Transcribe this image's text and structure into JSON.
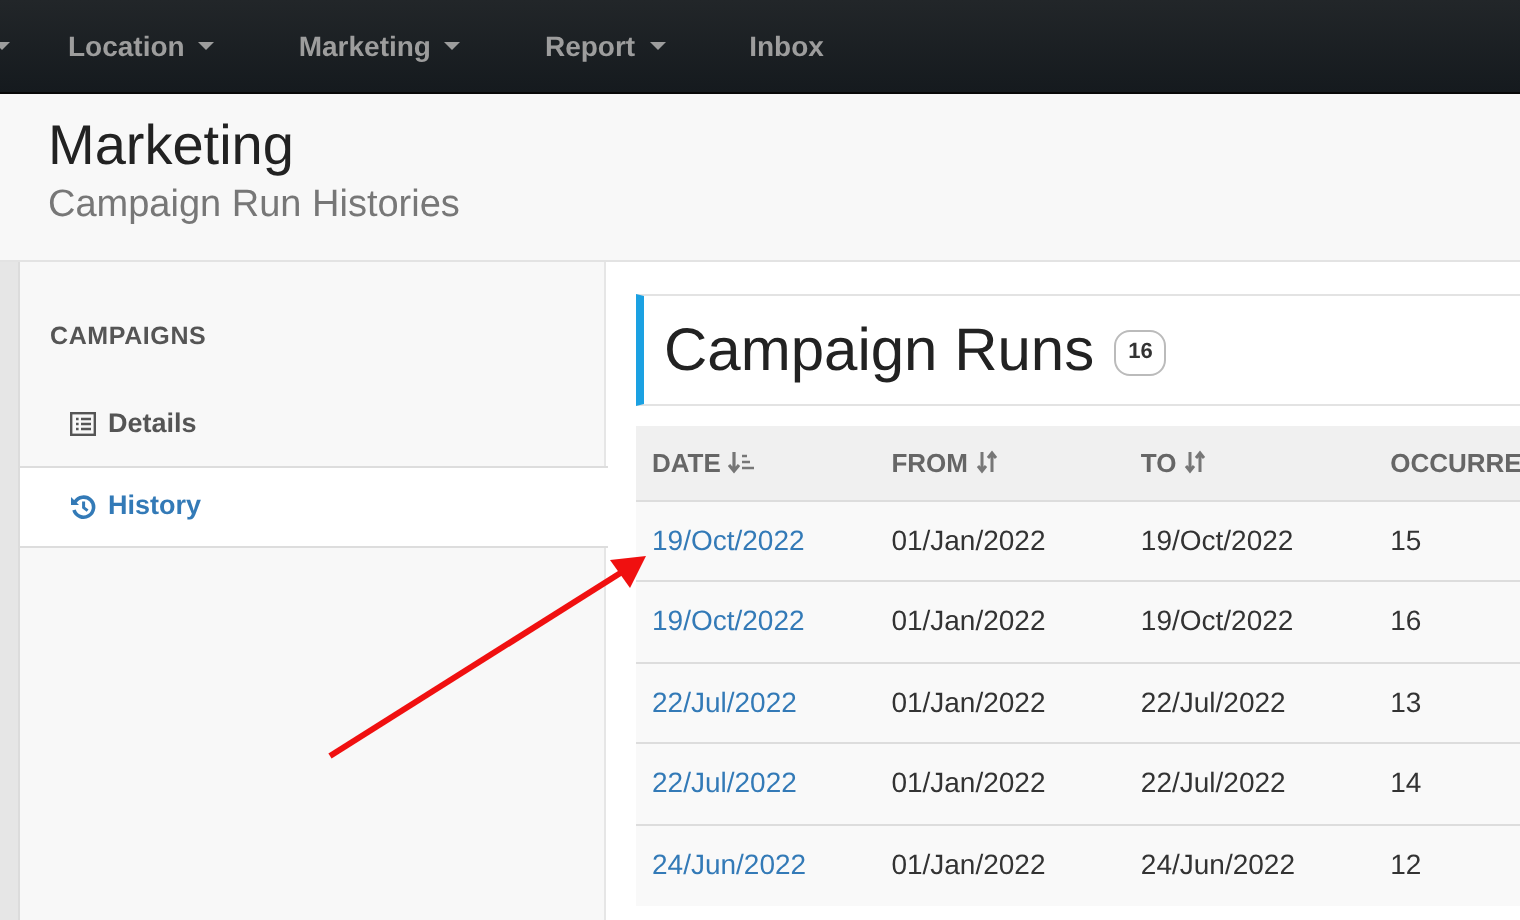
{
  "navbar": {
    "items": [
      {
        "label": "Location",
        "dropdown": true
      },
      {
        "label": "Marketing",
        "dropdown": true
      },
      {
        "label": "Report",
        "dropdown": true
      },
      {
        "label": "Inbox",
        "dropdown": false
      }
    ]
  },
  "page_header": {
    "title": "Marketing",
    "subtitle": "Campaign Run Histories"
  },
  "sidebar": {
    "heading": "CAMPAIGNS",
    "items": [
      {
        "label": "Details",
        "kind": "list",
        "selected": false
      },
      {
        "label": "History",
        "kind": "history",
        "selected": true
      }
    ]
  },
  "panel": {
    "title": "Campaign Runs",
    "count": "16"
  },
  "table": {
    "columns": [
      {
        "label": "DATE",
        "kind": "sorted"
      },
      {
        "label": "FROM",
        "kind": "sortable"
      },
      {
        "label": "TO",
        "kind": "sortable"
      },
      {
        "label": "OCCURRE",
        "kind": "plain"
      }
    ],
    "rows": [
      [
        "19/Oct/2022",
        "01/Jan/2022",
        "19/Oct/2022",
        "15"
      ],
      [
        "19/Oct/2022",
        "01/Jan/2022",
        "19/Oct/2022",
        "16"
      ],
      [
        "22/Jul/2022",
        "01/Jan/2022",
        "22/Jul/2022",
        "13"
      ],
      [
        "22/Jul/2022",
        "01/Jan/2022",
        "22/Jul/2022",
        "14"
      ],
      [
        "24/Jun/2022",
        "01/Jan/2022",
        "24/Jun/2022",
        "12"
      ]
    ]
  }
}
